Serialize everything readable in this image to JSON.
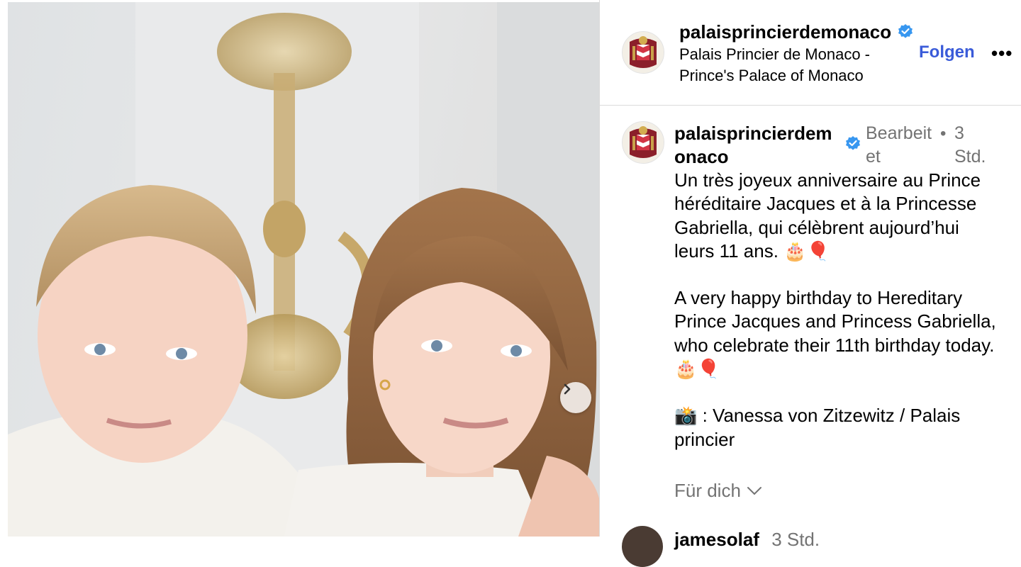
{
  "post_header": {
    "username": "palaisprincierdemonaco",
    "display_name": "Palais Princier de Monaco - Prince's Palace of Monaco",
    "follow_label": "Folgen",
    "more_label": "•••"
  },
  "caption": {
    "username": "palaisprincierdemonaco",
    "edited_label": "Bearbeitet",
    "separator": "•",
    "time": "3 Std.",
    "fr_text": "Un très joyeux anniversaire au Prince héréditaire Jacques et à la Princesse Gabriella, qui célèbrent aujourd’hui leurs 11 ans. 🎂🎈",
    "en_text": "A very happy birthday to Hereditary Prince Jacques and Princess Gabriella, who celebrate their 11th birthday today. 🎂🎈",
    "credit_text": "📸 : Vanessa von Zitzewitz / Palais princier",
    "for_you_label": "Für dich"
  },
  "next_comment": {
    "username": "jamesolaf",
    "time": "3 Std."
  },
  "colors": {
    "accent_link": "#3a5bd9",
    "verified": "#3897f0",
    "secondary_text": "#737373",
    "divider": "#dbdbdb"
  },
  "icons": {
    "verified": "verified-badge-icon",
    "next": "chevron-right-icon",
    "dropdown": "chevron-down-icon"
  }
}
